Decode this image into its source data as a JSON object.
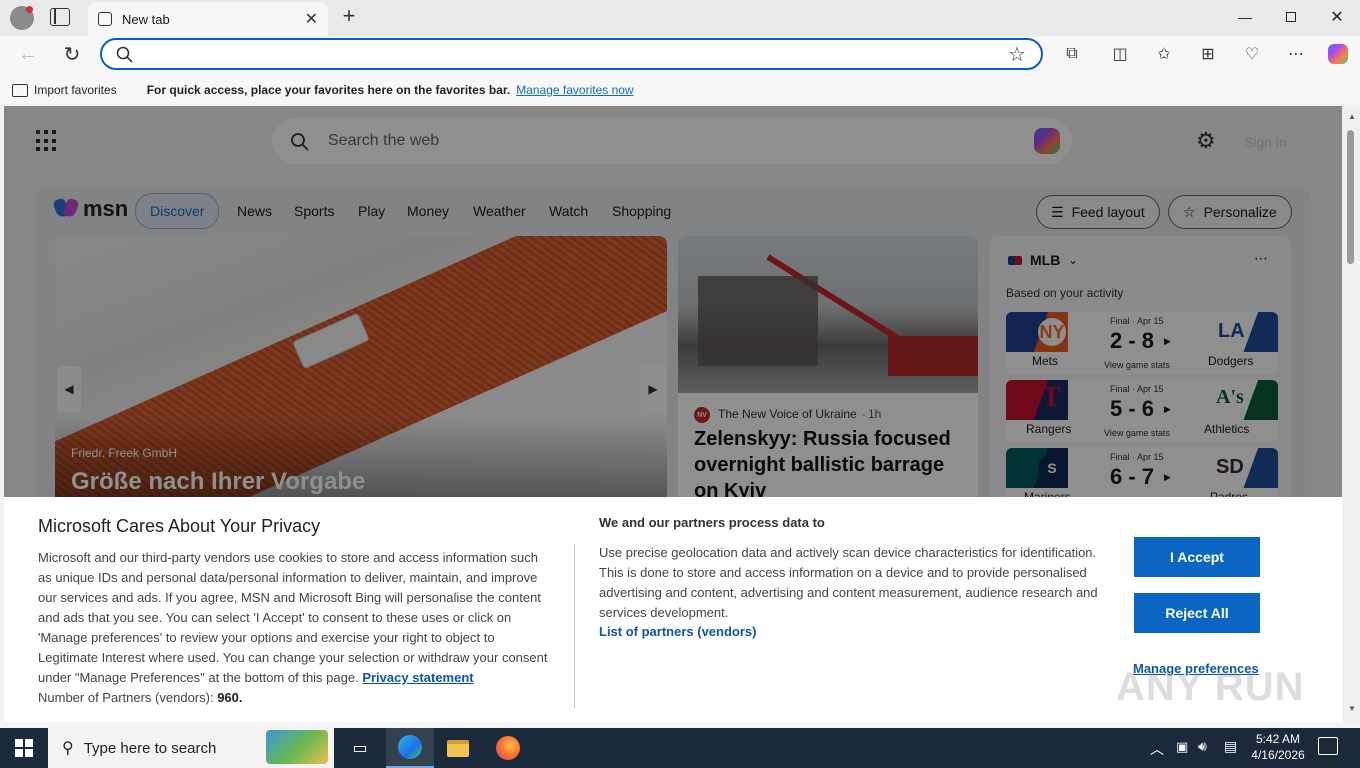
{
  "browser": {
    "tab_title": "New tab",
    "address_value": "",
    "favorites_bar": {
      "import_label": "Import favorites",
      "message": "For quick access, place your favorites here on the favorites bar.",
      "manage_link": "Manage favorites now"
    }
  },
  "msn": {
    "search_placeholder": "Search the web",
    "signin_label": "Sign in",
    "logo_text": "msn",
    "nav": [
      "Discover",
      "News",
      "Sports",
      "Play",
      "Money",
      "Weather",
      "Watch",
      "Shopping"
    ],
    "feed_layout_label": "Feed layout",
    "personalize_label": "Personalize",
    "hero": {
      "source": "Friedr. Freek GmbH",
      "title": "Größe nach Ihrer Vorgabe"
    },
    "news": {
      "source_badge": "NV",
      "source": "The New Voice of Ukraine",
      "time": "1h",
      "title": "Zelenskyy: Russia focused overnight ballistic barrage on Kyiv"
    },
    "mlb": {
      "league": "MLB",
      "subtitle": "Based on your activity",
      "games": [
        {
          "status": "Final · Apr 15",
          "score": "2 - 8",
          "link": "View game stats",
          "home": "Mets",
          "away": "Dodgers",
          "home_abbr": "NY",
          "away_abbr": "LA"
        },
        {
          "status": "Final · Apr 15",
          "score": "5 - 6",
          "link": "View game stats",
          "home": "Rangers",
          "away": "Athletics",
          "home_abbr": "T",
          "away_abbr": "A's"
        },
        {
          "status": "Final · Apr 15",
          "score": "6 - 7",
          "link": "",
          "home": "Mariners",
          "away": "Padres",
          "home_abbr": "S",
          "away_abbr": "SD"
        }
      ]
    }
  },
  "privacy": {
    "title": "Microsoft Cares About Your Privacy",
    "body": "Microsoft and our third-party vendors use cookies to store and access information such as unique IDs and personal data/personal information to deliver, maintain, and improve our services and ads. If you agree, MSN and Microsoft Bing will personalise the content and ads that you see. You can select 'I Accept' to consent to these uses or click on 'Manage preferences' to review your options and exercise your right to object to Legitimate Interest where used. You can change your selection or withdraw your consent under \"Manage Preferences\" at the bottom of this page.",
    "privacy_link": "Privacy statement",
    "partners_label": "Number of Partners (vendors):",
    "partners_count": "960.",
    "right_title": "We and our partners process data to",
    "right_body": "Use precise geolocation data and actively scan device characteristics for identification. This is done to store and access information on a device and to provide personalised advertising and content, advertising and content measurement, audience research and services development.",
    "partners_link": "List of partners (vendors)",
    "accept_label": "I Accept",
    "reject_label": "Reject All",
    "manage_label": "Manage preferences"
  },
  "taskbar": {
    "search_placeholder": "Type here to search",
    "time": "5:42 AM",
    "date": "4/16/2026"
  },
  "watermark": "ANY RUN",
  "colors": {
    "accent": "#0f6cbd",
    "button_primary": "#0a66c2",
    "taskbar": "#1b2a3a"
  }
}
